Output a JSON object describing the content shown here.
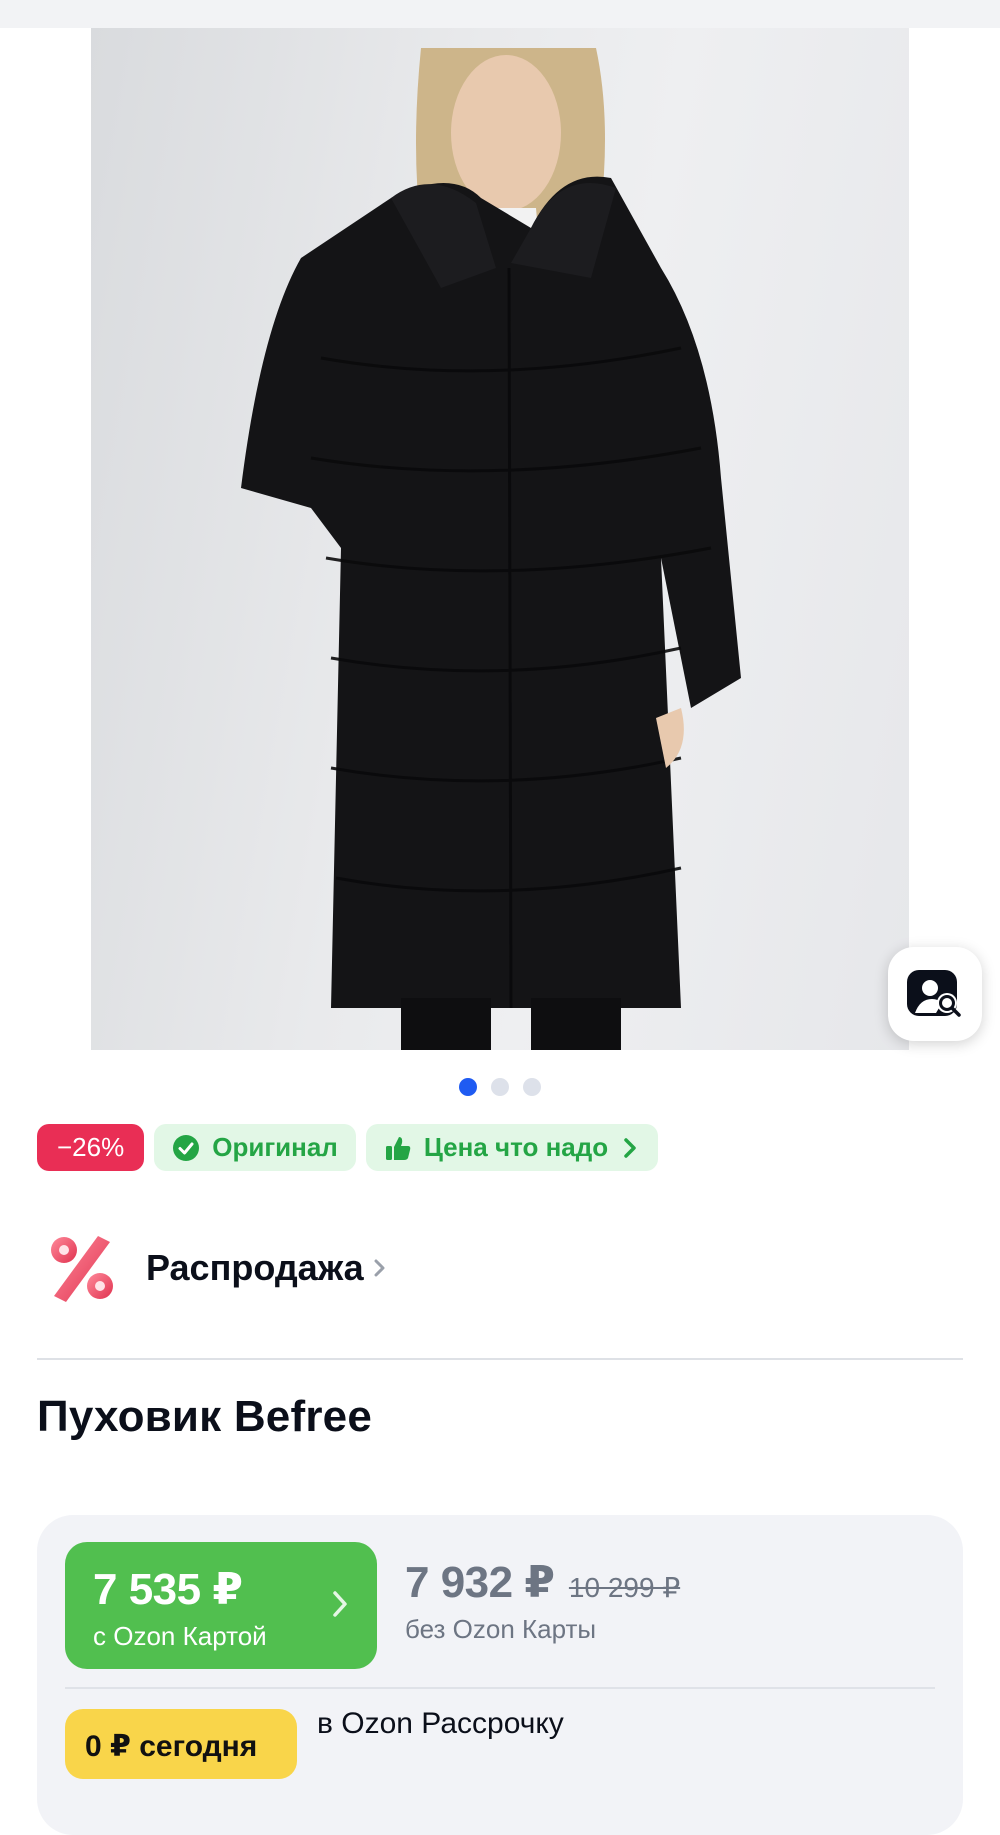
{
  "gallery": {
    "current_slide": 1,
    "total_slides": 3
  },
  "badges": {
    "discount": "−26%",
    "original": "Оригинал",
    "good_price": "Цена что надо"
  },
  "promo": {
    "label": "Распродажа"
  },
  "product": {
    "title": "Пуховик Befree"
  },
  "price": {
    "card_price": "7 535 ₽",
    "card_label": "с Ozon Картой",
    "regular_price": "7 932 ₽",
    "old_price": "10 299 ₽",
    "regular_label": "без Ozon Карты"
  },
  "installment": {
    "badge": "0 ₽ сегодня",
    "label": "в Ozon Рассрочку"
  },
  "colors": {
    "discount": "#e92e55",
    "green_badge_bg": "#e2f7e6",
    "green_text": "#24a545",
    "card_price_bg": "#51bf4f",
    "installment_bg": "#f9d54a",
    "active_dot": "#1f5bf2"
  },
  "icons": [
    "visual-search-icon",
    "check-circle-icon",
    "thumbs-up-icon",
    "chevron-right-icon",
    "percent-icon"
  ]
}
